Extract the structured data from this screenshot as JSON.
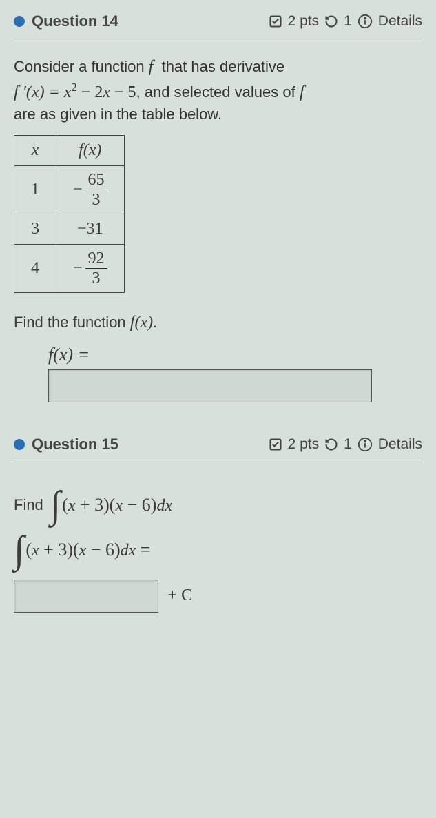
{
  "q14": {
    "header": {
      "title": "Question 14",
      "points": "2 pts",
      "attempts": "1",
      "details": "Details"
    },
    "prompt_line1": "Consider a function ",
    "prompt_fn": "f",
    "prompt_line1b": " that has derivative",
    "derivative_lhs": "f ′(x) = ",
    "derivative_rhs": "x² − 2x − 5",
    "prompt_line2b": ", and selected values of ",
    "prompt_fn2": "f",
    "prompt_line3": "are as given in the table below.",
    "table": {
      "h1": "x",
      "h2": "f(x)",
      "rows": [
        {
          "x": "1",
          "neg": "−",
          "num": "65",
          "den": "3",
          "frac": true
        },
        {
          "x": "3",
          "val": "−31",
          "frac": false
        },
        {
          "x": "4",
          "neg": "−",
          "num": "92",
          "den": "3",
          "frac": true
        }
      ]
    },
    "find_prompt_a": "Find the function ",
    "find_prompt_fn": "f(x)",
    "find_prompt_b": ".",
    "answer_label": "f(x) ="
  },
  "q15": {
    "header": {
      "title": "Question 15",
      "points": "2 pts",
      "attempts": "1",
      "details": "Details"
    },
    "find_label": "Find",
    "integrand": "(x + 3)(x − 6)dx",
    "eq_integrand": "(x + 3)(x − 6)dx =",
    "plus_c": "+ C"
  }
}
